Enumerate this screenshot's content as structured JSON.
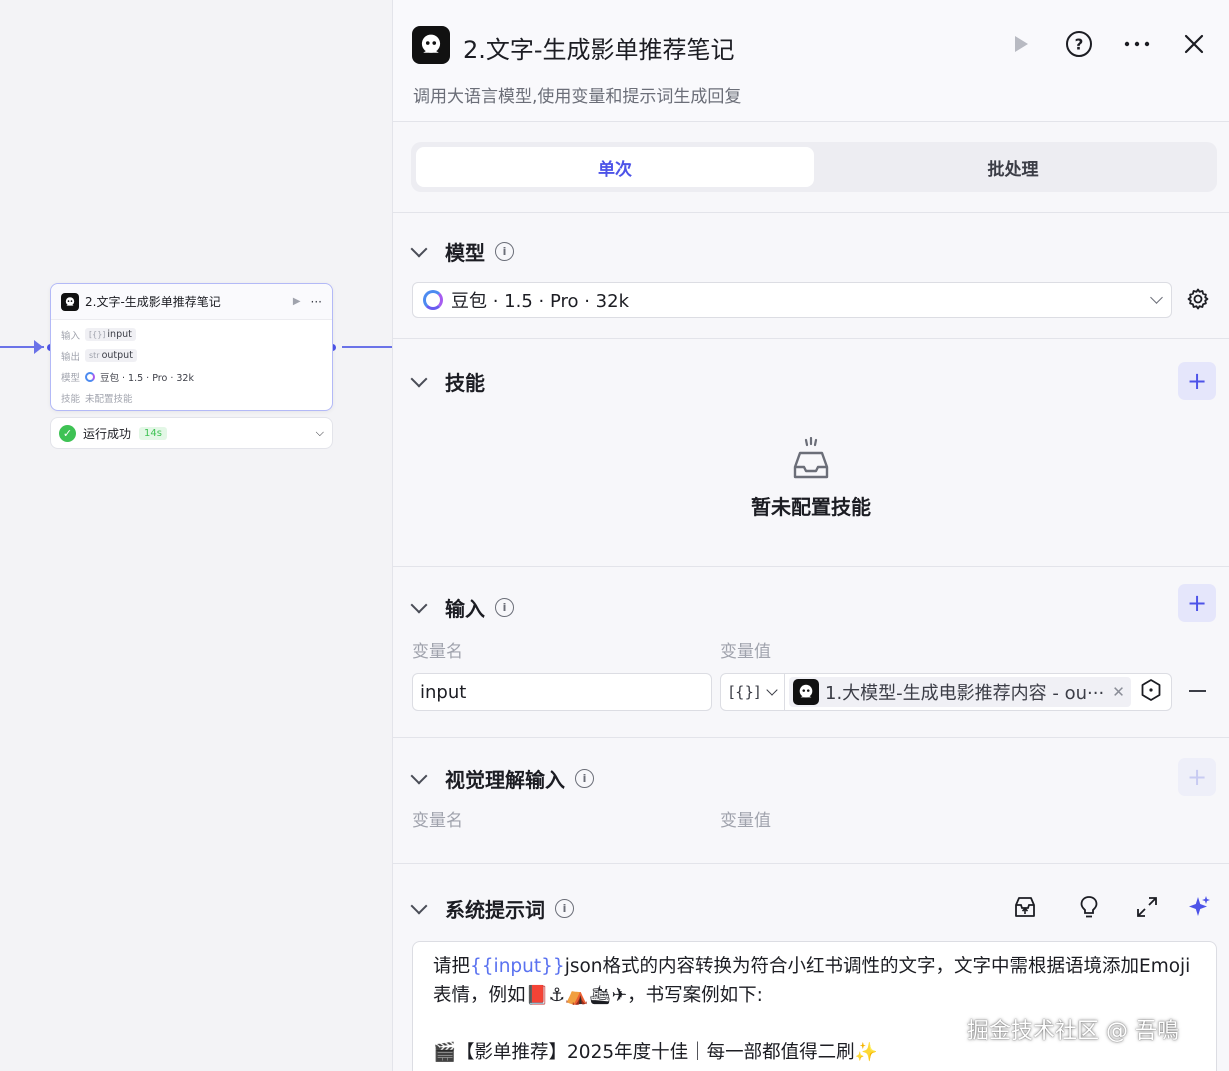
{
  "canvas_node": {
    "title": "2.文字-生成影单推荐笔记",
    "input_label": "输入",
    "input_type": "[{}]",
    "input_value": "input",
    "output_label": "输出",
    "output_type": "str",
    "output_value": "output",
    "model_label": "模型",
    "model_value": "豆包 · 1.5 · Pro · 32k",
    "skill_label": "技能",
    "skill_value": "未配置技能",
    "run_status": "运行成功",
    "run_time": "14s"
  },
  "panel": {
    "title": "2.文字-生成影单推荐笔记",
    "subtitle": "调用大语言模型,使用变量和提示词生成回复",
    "tabs": [
      {
        "label": "单次",
        "active": true
      },
      {
        "label": "批处理",
        "active": false
      }
    ],
    "model_section": {
      "title": "模型",
      "selected": "豆包 · 1.5 · Pro · 32k"
    },
    "skill_section": {
      "title": "技能",
      "empty_text": "暂未配置技能"
    },
    "input_section": {
      "title": "输入",
      "col_name": "变量名",
      "col_value": "变量值",
      "rows": [
        {
          "name": "input",
          "type_glyph": "[{}]",
          "ref": "1.大模型-生成电影推荐内容 - ou···"
        }
      ]
    },
    "vision_section": {
      "title": "视觉理解输入",
      "col_name": "变量名",
      "col_value": "变量值"
    },
    "prompt_section": {
      "title": "系统提示词",
      "text_before_var": "请把",
      "var": "{{input}}",
      "text_after_var": "json格式的内容转换为符合小红书调性的文字，文字中需根据语境添加Emoji表情，例如📕⚓⛺🛳✈，书写案例如下:",
      "line3": "🎬【影单推荐】2025年度十佳｜每一部都值得二刷✨"
    }
  },
  "watermark": "掘金技术社区 @ 吾鳴",
  "colors": {
    "accent": "#4d53e8",
    "success": "#3ec254",
    "edge": "#6a72e8"
  },
  "icons": [
    "play-icon",
    "help-icon",
    "more-icon",
    "close-icon",
    "gear-icon",
    "plus-icon",
    "empty-box-icon",
    "minus-icon",
    "library-icon",
    "bulb-icon",
    "expand-icon",
    "sparkle-icon"
  ]
}
